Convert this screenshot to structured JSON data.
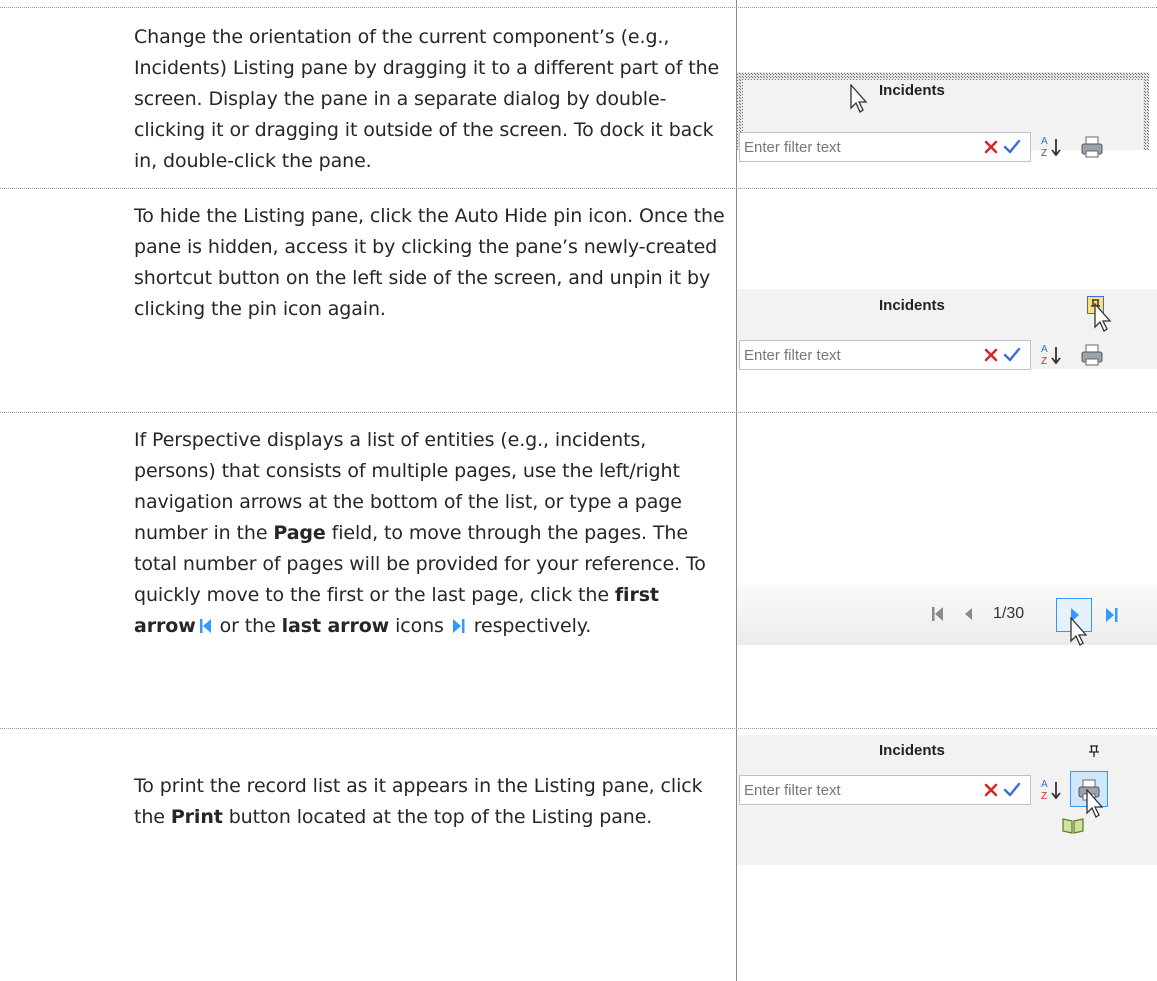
{
  "rows": [
    {
      "text": "Change the orientation of the current component’s (e.g., Incidents) Listing pane by dragging it to a different part of the screen. Display the pane in a separate dialog by double-clicking it or dragging it outside of the screen. To dock it back in, double-click the pane."
    },
    {
      "text": "To hide the Listing pane, click the Auto Hide pin icon. Once the pane is hidden, access it by clicking the pane’s newly-created shortcut button on the left side of the screen, and unpin it by clicking the pin icon again."
    },
    {
      "text_a": "If Perspective displays a list of entities (e.g., incidents, persons) that consists of multiple pages, use the left/right navigation arrows at the bottom of the list, or type a page number in the ",
      "bold_page": "Page",
      "text_b": " field, to move through the pages. The total number of pages will be provided for your reference. To quickly move to the first or the last page, click the ",
      "bold_first": "first arrow",
      "text_c": " or the ",
      "bold_last": "last arrow",
      "text_d": " icons ",
      "text_e": "respectively."
    },
    {
      "text_a": "To print the record list as it appears in the Listing pane, click the ",
      "bold_print": "Print",
      "text_b": " button located at the top of the Listing pane."
    }
  ],
  "screens": {
    "pane_title": "Incidents",
    "filter_placeholder": "Enter filter text",
    "pin_glyph": "ᵖ",
    "pager_value": "1/30"
  },
  "colors": {
    "accent": "#3399ff",
    "clear_x": "#d9262b",
    "check": "#3a6fd6",
    "grid_line": "#9a9a9a"
  },
  "icons": [
    "cursor-icon",
    "pin-icon",
    "clear-icon",
    "apply-icon",
    "sort-az-icon",
    "print-icon",
    "first-page-icon",
    "prev-page-icon",
    "next-page-icon",
    "last-page-icon",
    "book-icon"
  ]
}
